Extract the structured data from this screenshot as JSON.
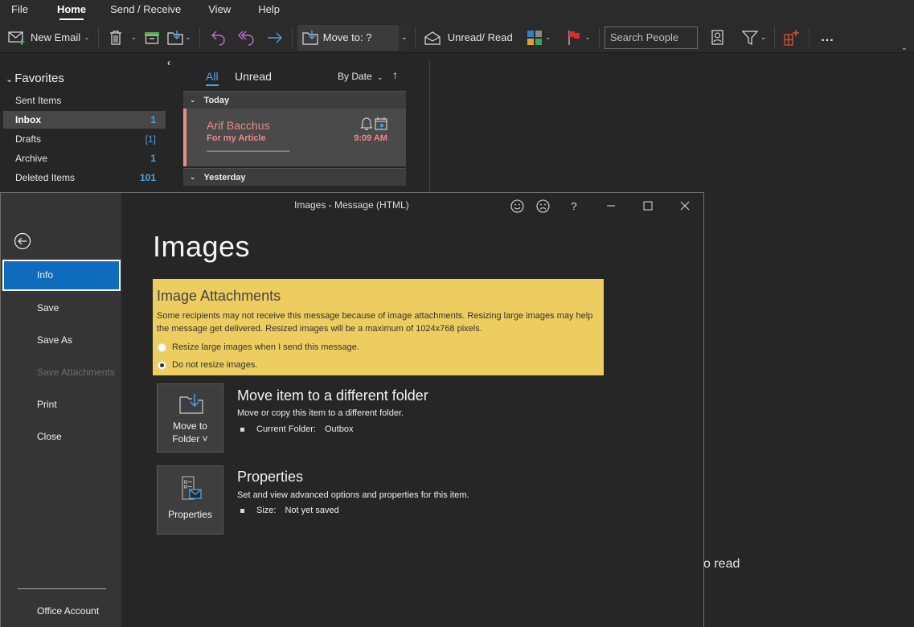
{
  "ribbon": {
    "tabs": [
      "File",
      "Home",
      "Send / Receive",
      "View",
      "Help"
    ],
    "active_tab": "Home",
    "toolbar": {
      "new_email": "New Email",
      "move_to": "Move to: ?",
      "unread_read": "Unread/ Read",
      "search_people_placeholder": "Search People",
      "more": "..."
    }
  },
  "folders": {
    "favorites_label": "Favorites",
    "items": [
      {
        "name": "Sent Items",
        "count": ""
      },
      {
        "name": "Inbox",
        "count": "1"
      },
      {
        "name": "Drafts",
        "count": "[1]"
      },
      {
        "name": "Archive",
        "count": "1"
      },
      {
        "name": "Deleted Items",
        "count": "101"
      }
    ]
  },
  "message_list": {
    "filters": [
      "All",
      "Unread"
    ],
    "sort_label": "By Date",
    "groups": [
      "Today",
      "Yesterday"
    ],
    "messages": [
      {
        "sender": "Arif Bacchus",
        "subject": "For my Article",
        "time": "9:09 AM",
        "preview": "--------------------------------------------"
      }
    ]
  },
  "reading_pane": {
    "partial_text": "o read"
  },
  "message_window": {
    "title": "Images  -  Message (HTML)",
    "help_label": "?",
    "nav": {
      "items": [
        "Info",
        "Save",
        "Save As",
        "Save Attachments",
        "Print",
        "Close"
      ],
      "active": "Info",
      "disabled": [
        "Save Attachments"
      ],
      "office_account": "Office Account"
    },
    "page_title": "Images",
    "image_attachments": {
      "title": "Image Attachments",
      "description": "Some recipients may not receive this message because of image attachments. Resizing large images may help the message get delivered. Resized images will be a maximum of 1024x768 pixels.",
      "options": [
        {
          "label": "Resize large images when I send this message.",
          "checked": false
        },
        {
          "label": "Do not resize images.",
          "checked": true
        }
      ]
    },
    "move_section": {
      "button_line1": "Move to",
      "button_line2": "Folder ˅",
      "title": "Move item to a different folder",
      "description": "Move or copy this item to a different folder.",
      "detail_key": "Current Folder:",
      "detail_value": "Outbox"
    },
    "properties_section": {
      "button_label": "Properties",
      "title": "Properties",
      "description": "Set and view advanced options and properties for this item.",
      "detail_key": "Size:",
      "detail_value": "Not yet saved"
    }
  },
  "colors": {
    "accent_blue": "#0f6cbd",
    "unread_red": "#ea8a8a",
    "warning_yellow": "#edcd5f",
    "count_blue": "#4aa3e8"
  }
}
